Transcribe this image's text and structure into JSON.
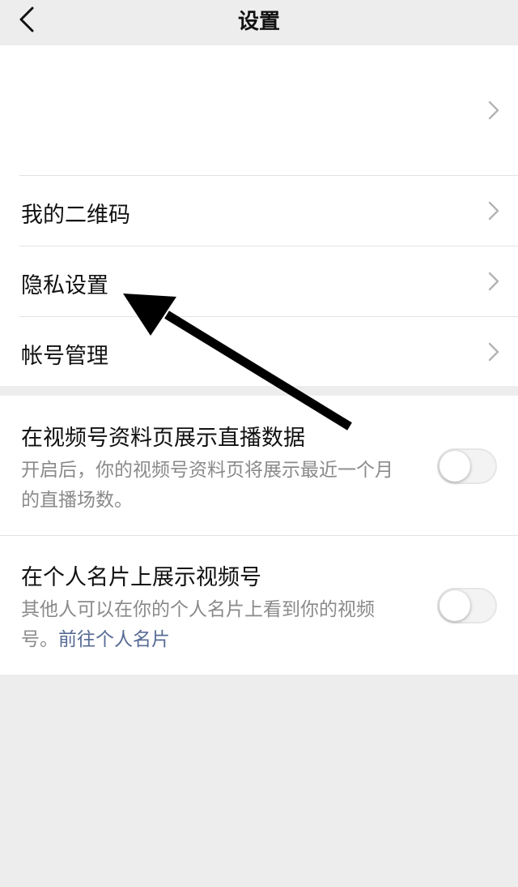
{
  "header": {
    "title": "设置",
    "back_icon": "chevron-left-icon"
  },
  "menu": {
    "items": [
      {
        "label": "",
        "icon": "chevron-right-icon"
      },
      {
        "label": "我的二维码",
        "icon": "chevron-right-icon"
      },
      {
        "label": "隐私设置",
        "icon": "chevron-right-icon"
      },
      {
        "label": "帐号管理",
        "icon": "chevron-right-icon"
      }
    ]
  },
  "options": [
    {
      "title": "在视频号资料页展示直播数据",
      "description": "开启后，你的视频号资料页将展示最近一个月的直播场数。",
      "enabled": false
    },
    {
      "title": "在个人名片上展示视频号",
      "description": "其他人可以在你的个人名片上看到你的视频号。",
      "link": "前往个人名片",
      "enabled": false
    }
  ],
  "colors": {
    "background": "#ededed",
    "card": "#ffffff",
    "link": "#576b95",
    "secondary_text": "#8a8a8a",
    "annotation_arrow": "#000000"
  },
  "annotation": {
    "icon": "arrow-pointer-icon",
    "target": "隐私设置"
  }
}
